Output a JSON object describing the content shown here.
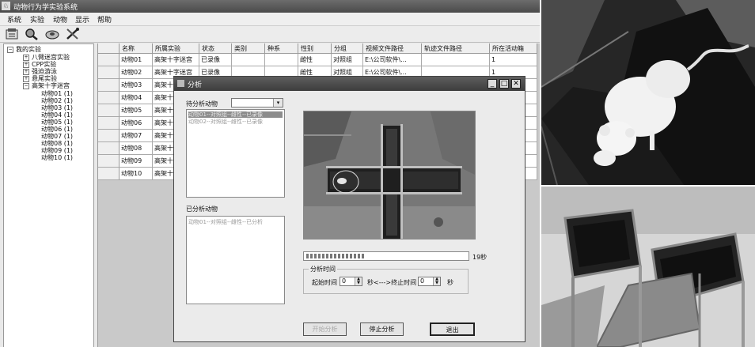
{
  "app": {
    "title": "动物行为学实验系统",
    "menu": [
      "系统",
      "实验",
      "动物",
      "显示",
      "帮助"
    ]
  },
  "tree": {
    "root": "我的实验",
    "children": [
      "八臂迷宫实验",
      "CPP实验",
      "强迫游泳",
      "悬尾实验",
      "高架十字迷宫"
    ],
    "animals": [
      "动物01 (1)",
      "动物02 (1)",
      "动物03 (1)",
      "动物04 (1)",
      "动物05 (1)",
      "动物06 (1)",
      "动物07 (1)",
      "动物08 (1)",
      "动物09 (1)",
      "动物10 (1)"
    ]
  },
  "grid": {
    "headers": [
      "名称",
      "所属实验",
      "状态",
      "类别",
      "种系",
      "性别",
      "分组",
      "视频文件路径",
      "轨迹文件路径",
      "所在活动箱"
    ],
    "rows": [
      [
        "动物01",
        "高架十字迷宫",
        "已录像",
        "",
        "",
        "雌性",
        "对照组",
        "E:\\公司软件\\...",
        "",
        "1"
      ],
      [
        "动物02",
        "高架十字迷宫",
        "已录像",
        "",
        "",
        "雌性",
        "对照组",
        "E:\\公司软件\\...",
        "",
        "1"
      ],
      [
        "动物03",
        "高架十",
        "",
        "",
        "",
        "",
        "",
        "",
        "",
        "1"
      ],
      [
        "动物04",
        "高架十",
        "",
        "",
        "",
        "",
        "",
        "",
        "",
        "1"
      ],
      [
        "动物05",
        "高架十",
        "",
        "",
        "",
        "",
        "",
        "",
        "",
        "1"
      ],
      [
        "动物06",
        "高架十",
        "",
        "",
        "",
        "",
        "",
        "",
        "",
        "1"
      ],
      [
        "动物07",
        "高架十",
        "",
        "",
        "",
        "",
        "",
        "",
        "",
        "1"
      ],
      [
        "动物08",
        "高架十",
        "",
        "",
        "",
        "",
        "",
        "",
        "",
        "1"
      ],
      [
        "动物09",
        "高架十",
        "",
        "",
        "",
        "",
        "",
        "",
        "",
        "1"
      ],
      [
        "动物10",
        "高架十",
        "",
        "",
        "",
        "",
        "",
        "",
        "",
        "1"
      ]
    ]
  },
  "dialog": {
    "title": "分析",
    "pending_label": "待分析动物",
    "pending_items": [
      "动物01--对照组--雌性--已录像",
      "动物02--对照组--雌性--已录像"
    ],
    "done_label": "已分析动物",
    "done_items": [
      "动物01--对照组--雌性--已分析"
    ],
    "progress_text": "19秒",
    "progress": 0.38,
    "time_group": "分析时间",
    "start_label": "起始时间",
    "start_value": "0",
    "unit_mid": "秒<--->终止时间",
    "end_value": "0",
    "unit_end": "秒",
    "btn_start": "开始分析",
    "btn_stop": "停止分析",
    "btn_exit": "退出"
  },
  "icons": {
    "toolbar": [
      "new-experiment-icon",
      "search-icon",
      "disc-icon",
      "tools-icon"
    ],
    "window": [
      "minimize-icon",
      "maximize-icon",
      "close-icon"
    ]
  }
}
